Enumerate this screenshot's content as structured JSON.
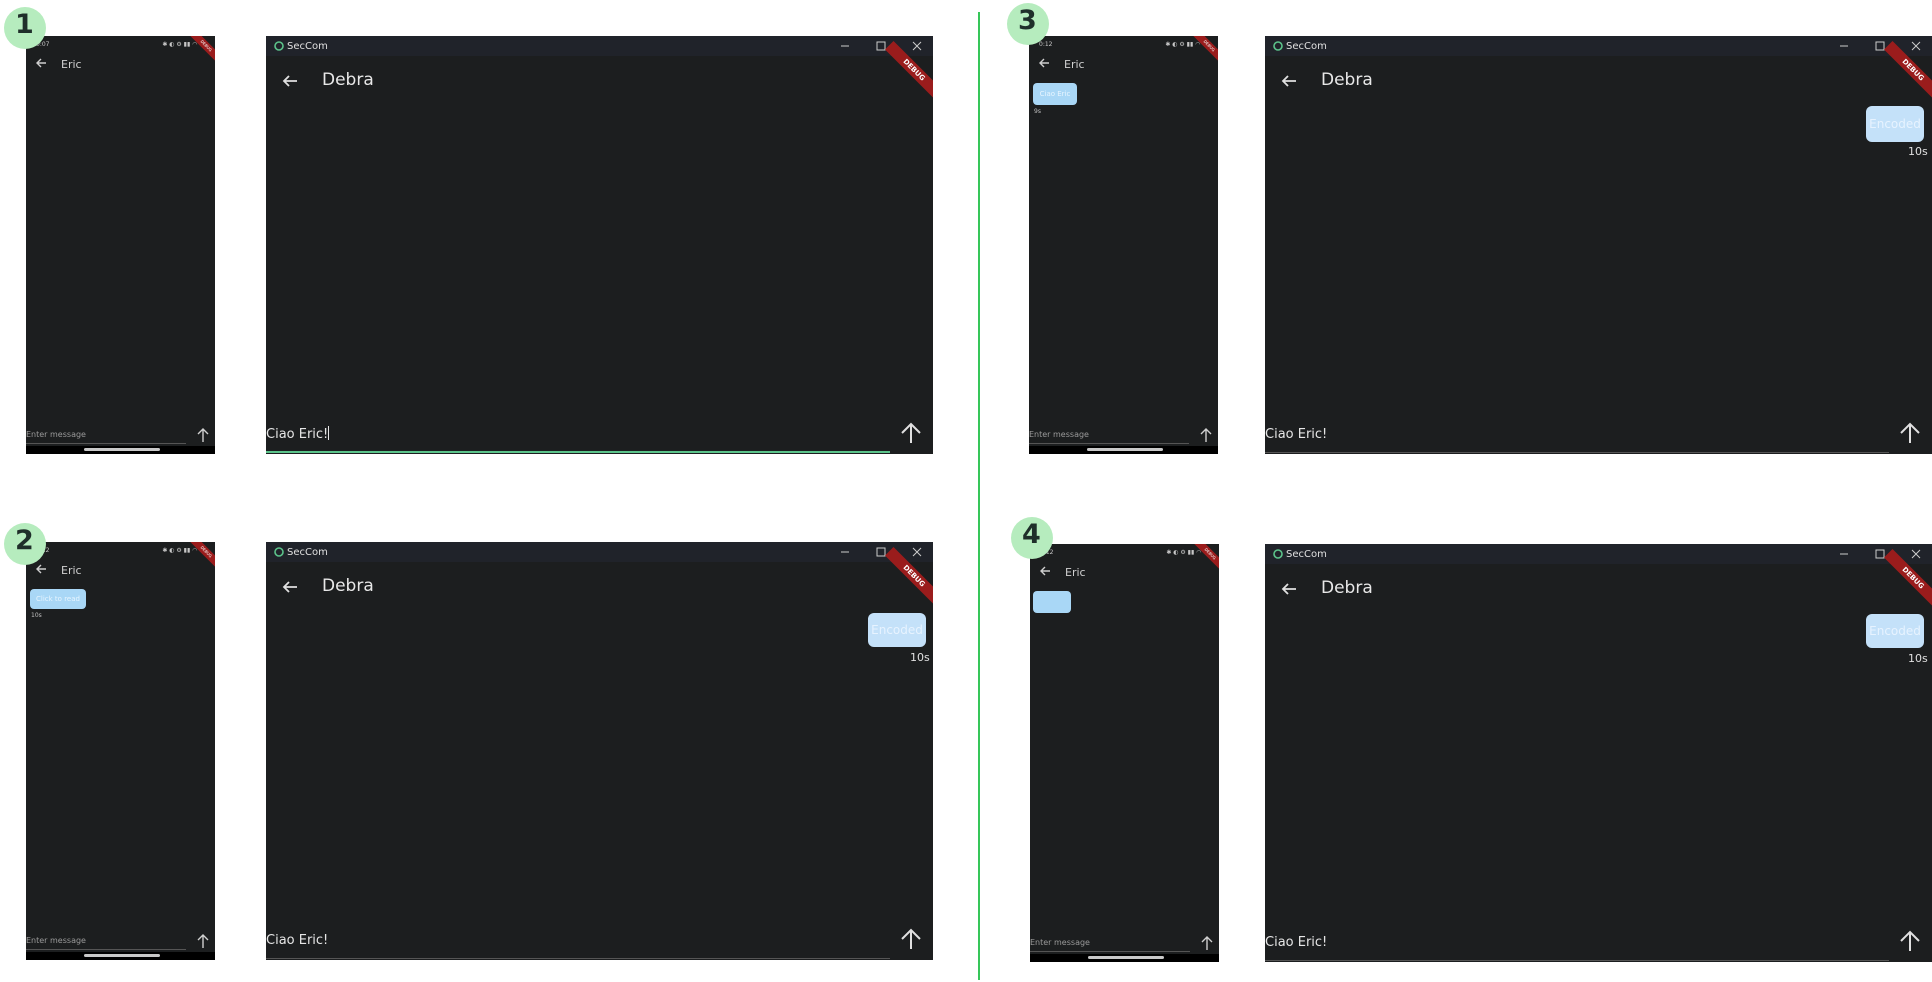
{
  "app": {
    "name": "SecCom",
    "debug_label": "DEBUG"
  },
  "panels": [
    {
      "step": "1",
      "phone": {
        "time": "0:07",
        "contact": "Eric",
        "placeholder": "Enter message",
        "bubble": "",
        "bubble_time": ""
      },
      "desktop": {
        "contact": "Debra",
        "input": "Ciao Eric!",
        "bubble": "",
        "bubble_time": ""
      }
    },
    {
      "step": "2",
      "phone": {
        "time": "0:12",
        "contact": "Eric",
        "placeholder": "Enter message",
        "bubble": "Click to read",
        "bubble_time": "10s"
      },
      "desktop": {
        "contact": "Debra",
        "input": "Ciao Eric!",
        "bubble": "Encoded",
        "bubble_time": "10s"
      }
    },
    {
      "step": "3",
      "phone": {
        "time": "0:12",
        "contact": "Eric",
        "placeholder": "Enter message",
        "bubble": "Ciao Eric",
        "bubble_time": "9s"
      },
      "desktop": {
        "contact": "Debra",
        "input": "Ciao Eric!",
        "bubble": "Encoded",
        "bubble_time": "10s"
      }
    },
    {
      "step": "4",
      "phone": {
        "time": "0:12",
        "contact": "Eric",
        "placeholder": "Enter message",
        "bubble": "",
        "bubble_time": ""
      },
      "desktop": {
        "contact": "Debra",
        "input": "Ciao Eric!",
        "bubble": "Encoded",
        "bubble_time": "10s"
      }
    }
  ],
  "icons": {
    "back": "arrow-left-icon",
    "send": "arrow-up-icon",
    "minimize": "minimize-icon",
    "maximize": "maximize-icon",
    "close": "close-icon",
    "app": "seccom-logo-icon"
  }
}
